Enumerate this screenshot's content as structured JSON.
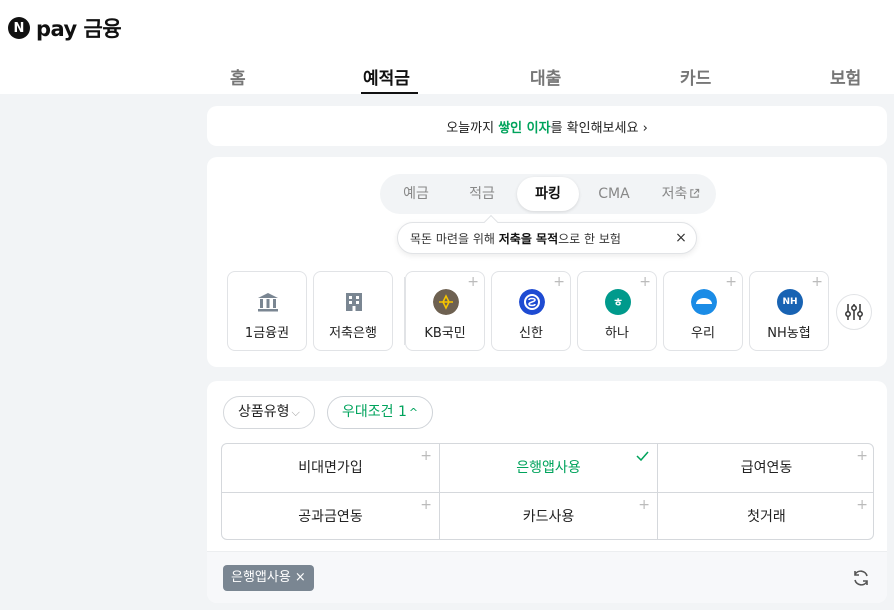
{
  "header": {
    "logo_letter": "N",
    "logo_text": "pay 금융"
  },
  "nav": {
    "tabs": [
      {
        "label": "홈"
      },
      {
        "label": "예적금"
      },
      {
        "label": "대출"
      },
      {
        "label": "카드"
      },
      {
        "label": "보험"
      }
    ],
    "active_index": 1
  },
  "banner": {
    "text_before": "오늘까지 ",
    "highlight": "쌓인 이자",
    "text_after": "를 확인해보세요 ›"
  },
  "product_tabs": {
    "items": [
      {
        "label": "예금"
      },
      {
        "label": "적금"
      },
      {
        "label": "파킹"
      },
      {
        "label": "CMA"
      },
      {
        "label": "저축"
      }
    ],
    "active_index": 2
  },
  "tooltip": {
    "text_before": "목돈 마련을 위해 ",
    "bold": "저축을 목적",
    "text_after": "으로 한 보험",
    "close_icon": "×"
  },
  "banks": [
    {
      "label": "1금융권",
      "icon": "bank-building-icon"
    },
    {
      "label": "저축은행",
      "icon": "office-building-icon"
    },
    {
      "label": "KB국민",
      "icon": "kb-logo-icon",
      "color": "#6e6151"
    },
    {
      "label": "신한",
      "icon": "shinhan-logo-icon",
      "color": "#1e4bd2"
    },
    {
      "label": "하나",
      "icon": "hana-logo-icon",
      "color": "#009a8c",
      "glyph": "ㅎ"
    },
    {
      "label": "우리",
      "icon": "woori-logo-icon",
      "color": "#1b8ce6"
    },
    {
      "label": "NH농협",
      "icon": "nh-logo-icon",
      "color": "#1863b3",
      "glyph": "NH"
    }
  ],
  "bank_plus": "+",
  "filters": {
    "product_type": "상품유형",
    "conditions": "우대조건 1",
    "chevron_down": "⌵",
    "chevron_up": "^"
  },
  "conditions_grid": [
    {
      "label": "비대면가입",
      "selected": false
    },
    {
      "label": "은행앱사용",
      "selected": true
    },
    {
      "label": "급여연동",
      "selected": false
    },
    {
      "label": "공과금연동",
      "selected": false
    },
    {
      "label": "카드사용",
      "selected": false
    },
    {
      "label": "첫거래",
      "selected": false
    }
  ],
  "selected_tags": [
    {
      "label": "은행앱사용 ×"
    }
  ],
  "colors": {
    "accent_green": "#00a35c",
    "tag_gray": "#7a8692"
  }
}
